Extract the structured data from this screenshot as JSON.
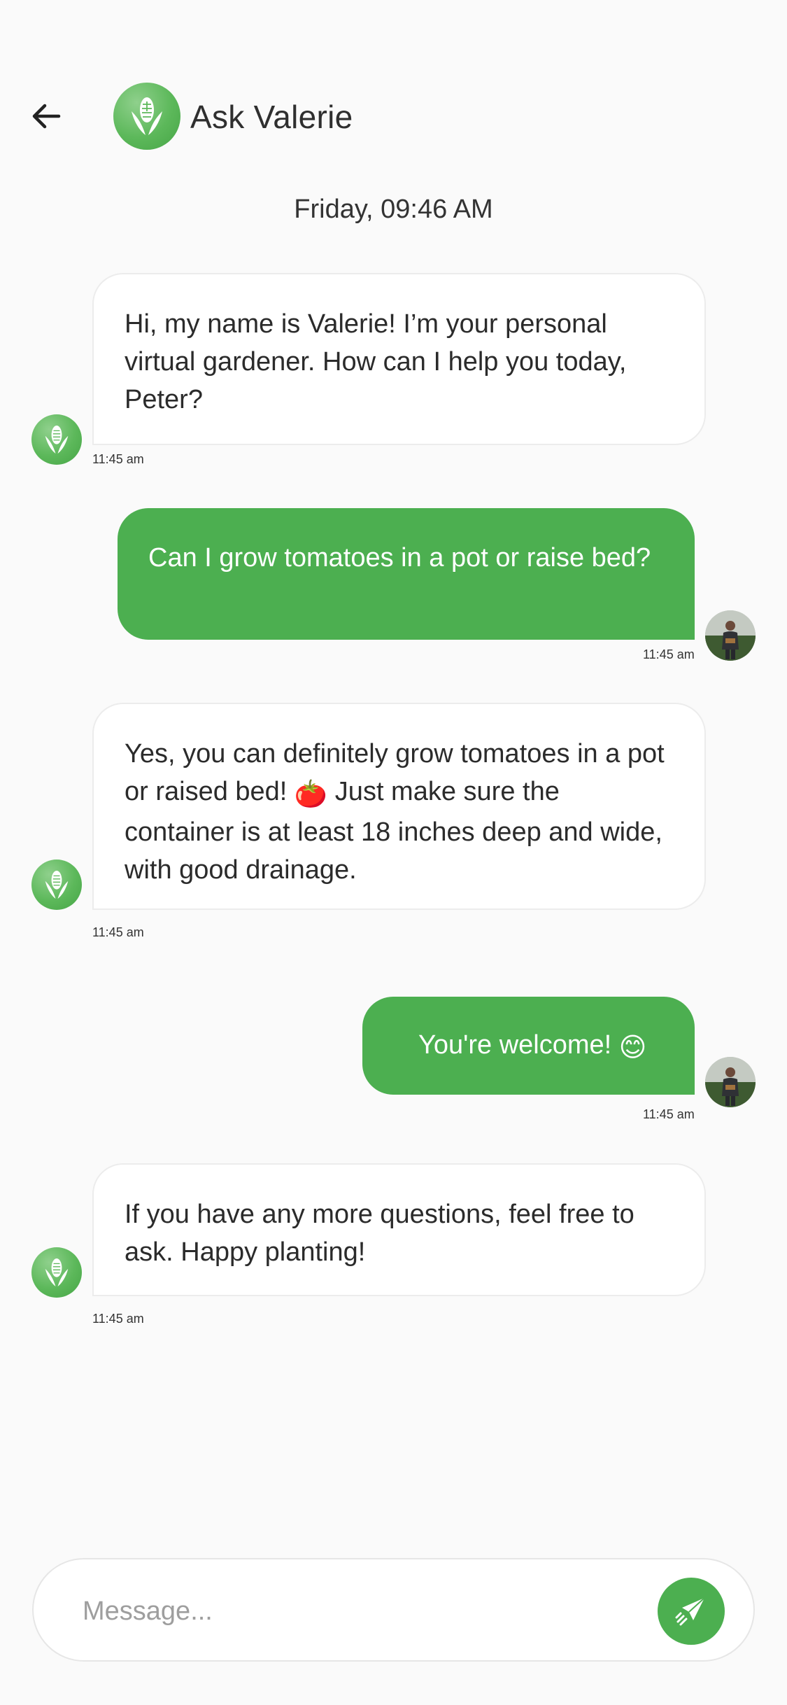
{
  "header": {
    "title": "Ask Valerie",
    "back_icon": "arrow-left-icon",
    "avatar_icon": "corn-icon"
  },
  "date_label": "Friday, 09:46 AM",
  "messages": [
    {
      "from": "bot",
      "text": "Hi, my name is Valerie! I’m your personal virtual gardener. How can I help you today, Peter?",
      "time": "11:45 am"
    },
    {
      "from": "user",
      "text": "Can I grow tomatoes in a pot or raise bed?",
      "time": "11:45 am"
    },
    {
      "from": "bot",
      "text_before": "Yes, you can definitely grow tomatoes in a pot or raised bed! ",
      "emoji": "🍅",
      "text_after": " Just make sure the container is at least 18 inches deep and wide, with good drainage.",
      "time": "11:45 am"
    },
    {
      "from": "user",
      "text": "You're welcome! ",
      "emoji": "😊",
      "time": "11:45 am"
    },
    {
      "from": "bot",
      "text": "If you have any more questions, feel free to ask. Happy planting!",
      "time": "11:45 am"
    }
  ],
  "composer": {
    "placeholder": "Message...",
    "value": "",
    "send_icon": "send-rocket-icon"
  },
  "colors": {
    "accent": "#4caf50",
    "background": "#fafafa",
    "bubble_in": "#ffffff"
  }
}
